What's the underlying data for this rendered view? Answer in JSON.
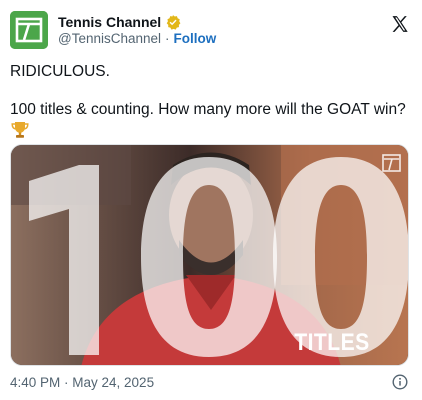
{
  "author": {
    "display_name": "Tennis Channel",
    "handle": "@TennisChannel",
    "separator": "·",
    "follow_label": "Follow",
    "verified_badge_color": "#e2b719",
    "avatar_color": "#4ca64a"
  },
  "tweet": {
    "lines": [
      "RIDICULOUS.",
      "100 titles & counting. How many more will the GOAT win?"
    ],
    "trophy_icon": "trophy-emoji"
  },
  "media": {
    "big_number": "100",
    "caption": "TITLES"
  },
  "footer": {
    "timestamp": "4:40 PM · May 24, 2025",
    "info_icon": "info-icon"
  },
  "colors": {
    "text": "#0f1419",
    "secondary": "#536471",
    "link": "#1d6fbf"
  }
}
